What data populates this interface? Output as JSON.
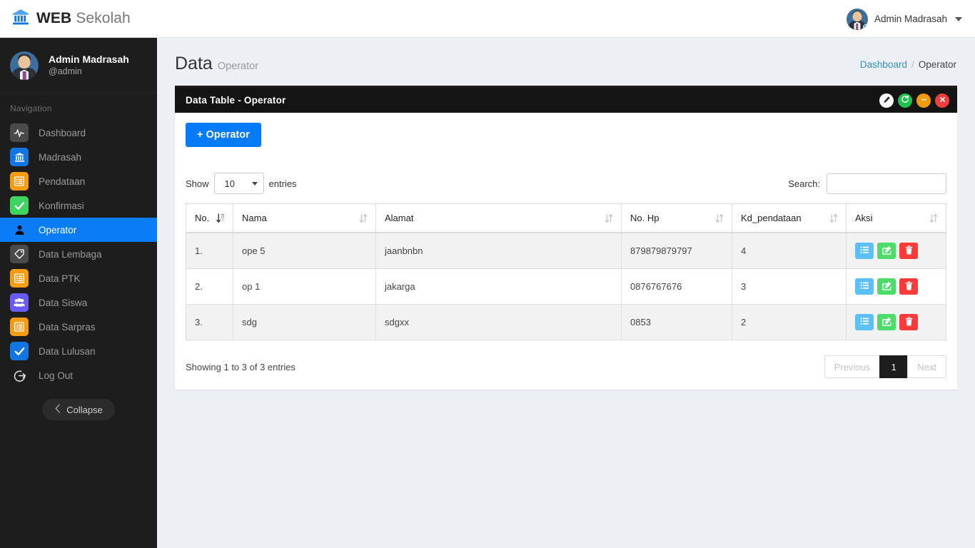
{
  "navbar": {
    "brand_bold": "WEB",
    "brand_light": "Sekolah",
    "brand_icon": "bank-icon",
    "user_name": "Admin Madrasah",
    "caret_icon": "chevron-down-icon"
  },
  "sidebar": {
    "user_name": "Admin Madrasah",
    "user_handle": "@admin",
    "nav_title": "Navigation",
    "items": [
      {
        "label": "Dashboard",
        "icon": "activity-pulse-icon",
        "active": false
      },
      {
        "label": "Madrasah",
        "icon": "bank-icon",
        "active": false
      },
      {
        "label": "Pendataan",
        "icon": "list-alt-icon",
        "active": false
      },
      {
        "label": "Konfirmasi",
        "icon": "check-square-icon",
        "active": false
      },
      {
        "label": "Operator",
        "icon": "user-icon",
        "active": true
      },
      {
        "label": "Data Lembaga",
        "icon": "tag-icon",
        "active": false
      },
      {
        "label": "Data PTK",
        "icon": "list-alt-icon",
        "active": false
      },
      {
        "label": "Data Siswa",
        "icon": "users-icon",
        "active": false
      },
      {
        "label": "Data Sarpras",
        "icon": "list-alt-icon",
        "active": false
      },
      {
        "label": "Data Lulusan",
        "icon": "check-circle-icon",
        "active": false
      },
      {
        "label": "Log Out",
        "icon": "sign-out-icon",
        "active": false
      }
    ],
    "collapse_label": "Collapse",
    "collapse_icon": "chevron-left-icon"
  },
  "page": {
    "title": "Data",
    "subtitle": "Operator",
    "breadcrumb_home": "Dashboard",
    "breadcrumb_sep": "/",
    "breadcrumb_current": "Operator"
  },
  "box": {
    "title": "Data Table - Operator",
    "tools": [
      {
        "name": "expand-tool",
        "icon": "pencil-icon",
        "color": "#fdfdfd"
      },
      {
        "name": "refresh-tool",
        "icon": "refresh-icon",
        "color": "#22c14e"
      },
      {
        "name": "minimize-tool",
        "icon": "minus-icon",
        "color": "#f49a0b"
      },
      {
        "name": "close-tool",
        "icon": "times-icon",
        "color": "#f03d3d"
      }
    ],
    "add_button": "+ Operator"
  },
  "datatable": {
    "length_prefix": "Show",
    "length_value": "10",
    "length_suffix": "entries",
    "search_label": "Search:",
    "search_value": "",
    "search_placeholder": "",
    "columns": [
      "No.",
      "Nama",
      "Alamat",
      "No. Hp",
      "Kd_pendataan",
      "Aksi"
    ],
    "rows": [
      {
        "no": "1.",
        "nama": "ope 5",
        "alamat": "jaanbnbn",
        "hp": "879879879797",
        "kd": "4"
      },
      {
        "no": "2.",
        "nama": "op 1",
        "alamat": "jakarga",
        "hp": "0876767676",
        "kd": "3"
      },
      {
        "no": "3.",
        "nama": "sdg",
        "alamat": "sdgxx",
        "hp": "0853",
        "kd": "2"
      }
    ],
    "action_buttons": [
      {
        "name": "detail-button",
        "icon": "list-icon",
        "color": "#5bc0f8"
      },
      {
        "name": "edit-button",
        "icon": "edit-square-icon",
        "color": "#4ddb69"
      },
      {
        "name": "delete-button",
        "icon": "trash-icon",
        "color": "#fc3a3a"
      }
    ],
    "info": "Showing 1 to 3 of 3 entries",
    "pagination": {
      "previous": "Previous",
      "current": "1",
      "next": "Next"
    }
  },
  "colors": {
    "accent_blue": "#047bf8",
    "sidebar_bg": "#1d1d1d",
    "box_header_bg": "#141414",
    "link_blue": "#3c8dbc"
  }
}
